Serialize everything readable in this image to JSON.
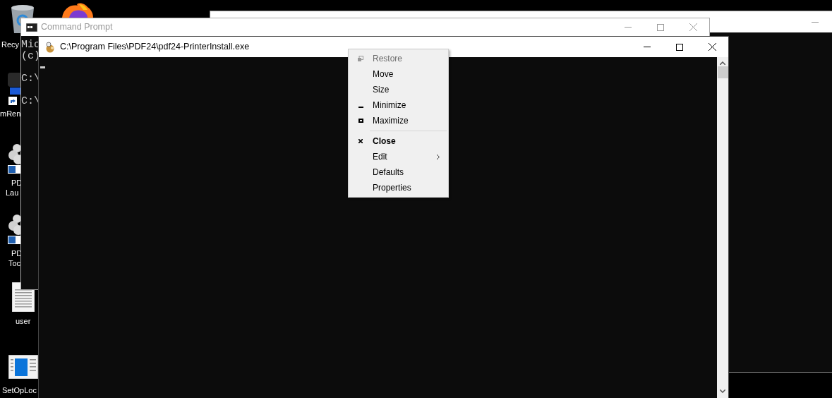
{
  "desktop_icons": [
    {
      "kind": "recycle",
      "label_lines": [
        "Recy"
      ]
    },
    {
      "kind": "browser"
    },
    {
      "kind": "app",
      "label_lines": [
        "mRen"
      ]
    },
    {
      "kind": "cloud",
      "label_lines": [
        "PD",
        "Lau"
      ]
    },
    {
      "kind": "cloud",
      "label_lines": [
        "PD",
        "Toc"
      ]
    },
    {
      "kind": "document",
      "label_lines": [
        "user"
      ]
    },
    {
      "kind": "settings",
      "label_lines": [
        "SetOpLoc"
      ]
    }
  ],
  "windows": [
    {
      "kind": "blank",
      "active": false
    },
    {
      "kind": "cmd",
      "title": "Command Prompt",
      "active": false,
      "lines": [
        "Mic",
        "(c)",
        "C:\\",
        "C:\\"
      ]
    },
    {
      "kind": "console",
      "title": "C:\\Program Files\\PDF24\\pdf24-PrinterInstall.exe",
      "active": true
    }
  ],
  "system_menu": {
    "items": [
      {
        "kind": "restore",
        "label": "Restore",
        "disabled": true,
        "default": false
      },
      {
        "kind": "plain",
        "label": "Move",
        "disabled": false,
        "default": false
      },
      {
        "kind": "plain",
        "label": "Size",
        "disabled": false,
        "default": false
      },
      {
        "kind": "minimize",
        "label": "Minimize",
        "disabled": false,
        "default": false
      },
      {
        "kind": "maximize",
        "label": "Maximize",
        "disabled": false,
        "default": false
      },
      {
        "kind": "separator"
      },
      {
        "kind": "close",
        "label": "Close",
        "disabled": false,
        "default": true
      },
      {
        "kind": "submenu",
        "label": "Edit",
        "disabled": false,
        "default": false
      },
      {
        "kind": "plain",
        "label": "Defaults",
        "disabled": false,
        "default": false
      },
      {
        "kind": "plain",
        "label": "Properties",
        "disabled": false,
        "default": false
      }
    ]
  }
}
